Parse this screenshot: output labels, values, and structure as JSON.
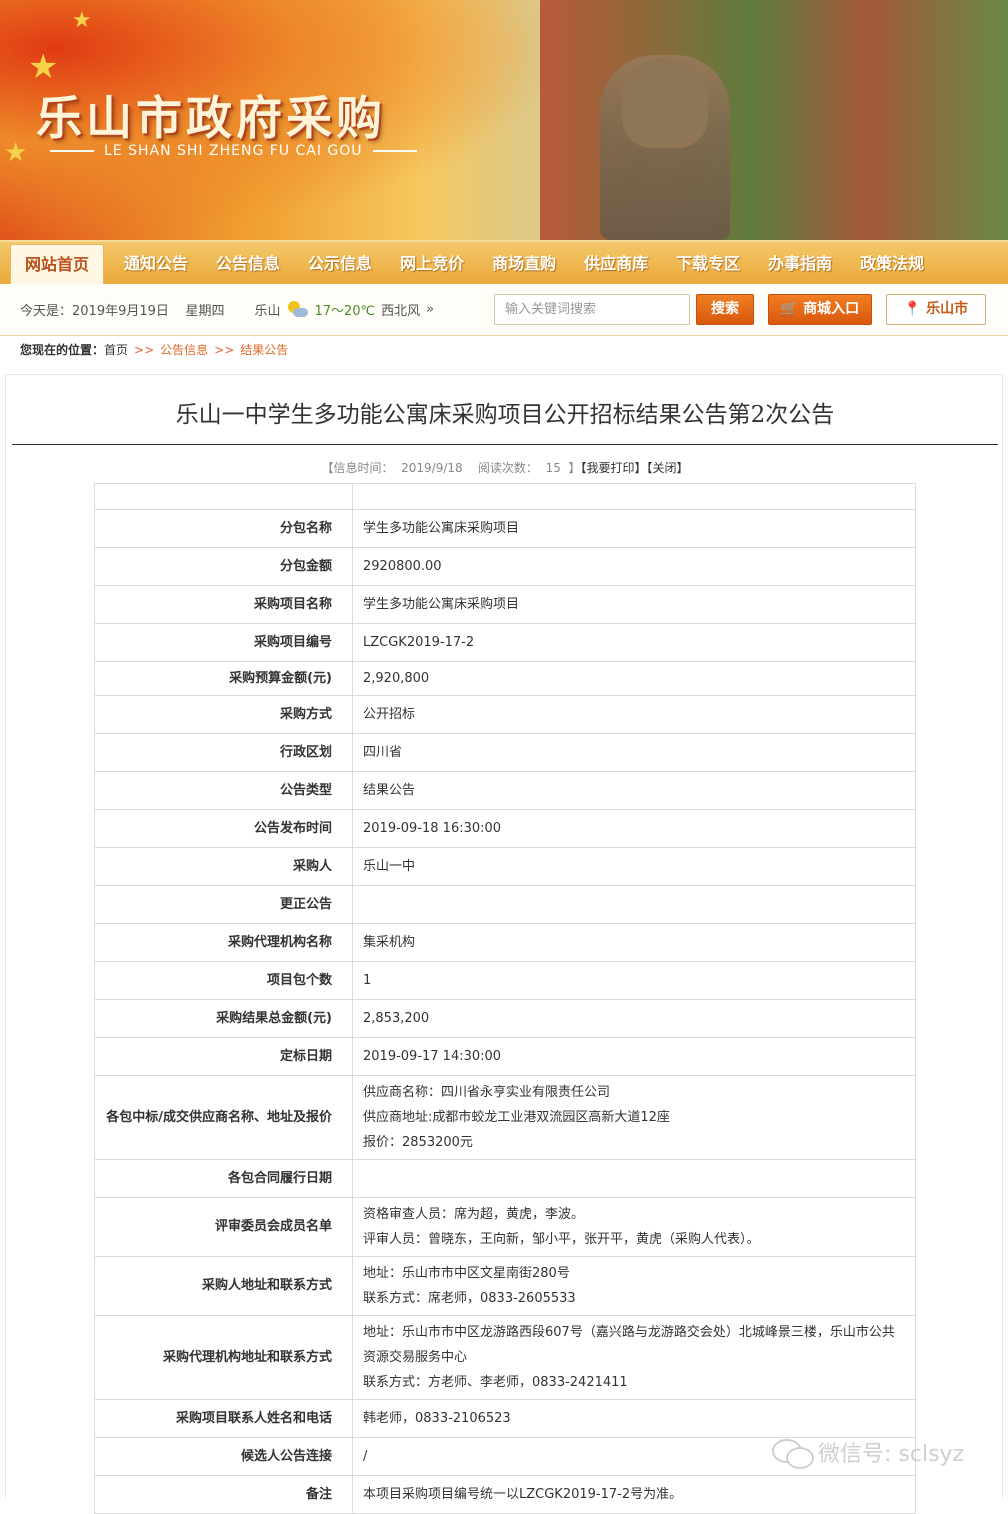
{
  "header": {
    "site_title": "乐山市政府采购",
    "site_pinyin": "LE SHAN SHI ZHENG FU CAI GOU"
  },
  "nav": {
    "items": [
      "网站首页",
      "通知公告",
      "公告信息",
      "公示信息",
      "网上竞价",
      "商场直购",
      "供应商库",
      "下载专区",
      "办事指南",
      "政策法规"
    ],
    "active": "网站首页"
  },
  "infobar": {
    "date": "今天是：2019年9月19日",
    "weekday": "星期四",
    "city": "乐山",
    "temp": "17～20℃",
    "wind": "西北风",
    "more": "»",
    "search_placeholder": "输入关键词搜索",
    "search_button": "搜索",
    "mall_button": "商城入口",
    "city_button": "乐山市"
  },
  "breadcrumb": {
    "label": "您现在的位置：",
    "home": "首页",
    "sep": ">>",
    "level1": "公告信息",
    "level2": "结果公告"
  },
  "article": {
    "title": "乐山一中学生多功能公寓床采购项目公开招标结果公告第2次公告",
    "meta_time_label": "【信息时间：",
    "meta_time": "2019/9/18",
    "meta_views_label": "阅读次数：",
    "meta_views": "15",
    "meta_close_bracket": "】",
    "print_link": "【我要打印】",
    "close_link": "【关闭】"
  },
  "table": {
    "rows": [
      {
        "k": "",
        "v": []
      },
      {
        "k": "分包名称",
        "v": [
          "学生多功能公寓床采购项目"
        ]
      },
      {
        "k": "分包金额",
        "v": [
          "2920800.00"
        ]
      },
      {
        "k": "采购项目名称",
        "v": [
          "学生多功能公寓床采购项目"
        ]
      },
      {
        "k": "采购项目编号",
        "v": [
          "LZCGK2019-17-2"
        ]
      },
      {
        "k": "采购预算金额(元)",
        "v": [
          "2,920,800"
        ]
      },
      {
        "k": "采购方式",
        "v": [
          "公开招标"
        ]
      },
      {
        "k": "行政区划",
        "v": [
          "四川省"
        ]
      },
      {
        "k": "公告类型",
        "v": [
          "结果公告"
        ]
      },
      {
        "k": "公告发布时间",
        "v": [
          "2019-09-18 16:30:00"
        ]
      },
      {
        "k": "采购人",
        "v": [
          "乐山一中"
        ]
      },
      {
        "k": "更正公告",
        "v": []
      },
      {
        "k": "采购代理机构名称",
        "v": [
          "集采机构"
        ]
      },
      {
        "k": "项目包个数",
        "v": [
          "1"
        ]
      },
      {
        "k": "采购结果总金额(元)",
        "v": [
          "2,853,200"
        ]
      },
      {
        "k": "定标日期",
        "v": [
          "2019-09-17 14:30:00"
        ]
      },
      {
        "k": "各包中标/成交供应商名称、地址及报价",
        "v": [
          "供应商名称：四川省永亨实业有限责任公司",
          "供应商地址:成都市蛟龙工业港双流园区高新大道12座",
          "报价：2853200元"
        ]
      },
      {
        "k": "各包合同履行日期",
        "v": []
      },
      {
        "k": "评审委员会成员名单",
        "v": [
          "资格审查人员：席为超，黄虎，李波。",
          "评审人员：曾晓东，王向新，邹小平，张开平，黄虎（采购人代表）。"
        ]
      },
      {
        "k": "采购人地址和联系方式",
        "v": [
          "地址：乐山市市中区文星南街280号",
          "联系方式：席老师，0833-2605533"
        ]
      },
      {
        "k": "采购代理机构地址和联系方式",
        "v": [
          "地址：乐山市市中区龙游路西段607号（嘉兴路与龙游路交会处）北城峰景三楼，乐山市公共资源交易服务中心",
          "联系方式：方老师、李老师，0833-2421411"
        ]
      },
      {
        "k": "采购项目联系人姓名和电话",
        "v": [
          "韩老师，0833-2106523"
        ]
      },
      {
        "k": "候选人公告连接",
        "v": [
          "/"
        ]
      },
      {
        "k": "备注",
        "v": [
          "本项目采购项目编号统一以LZCGK2019-17-2号为准。"
        ]
      }
    ]
  },
  "watermark": {
    "text": "微信号: sclsyz"
  }
}
